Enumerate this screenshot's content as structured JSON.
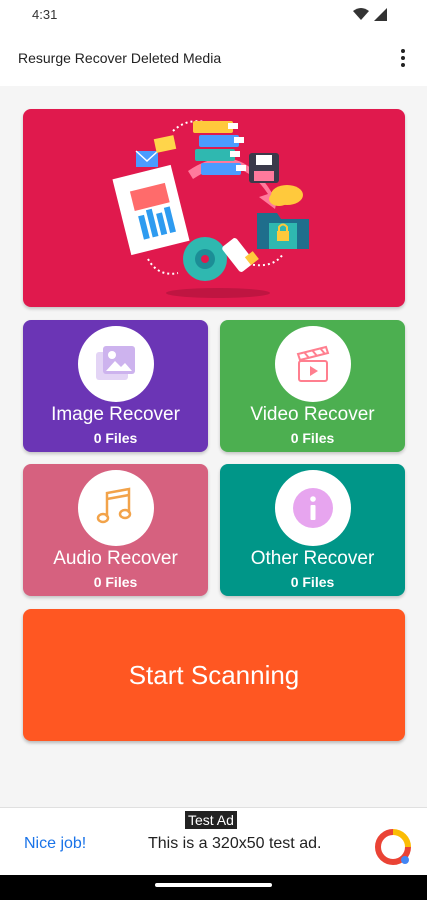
{
  "status_bar": {
    "time": "4:31"
  },
  "app_bar": {
    "title": "Resurge Recover Deleted Media"
  },
  "tiles": [
    {
      "title": "Image Recover",
      "count": "0 Files",
      "color": "#6b35b5",
      "icon": "image-icon"
    },
    {
      "title": "Video Recover",
      "count": "0 Files",
      "color": "#4caf50",
      "icon": "clapperboard-icon"
    },
    {
      "title": "Audio Recover",
      "count": "0 Files",
      "color": "#d6617f",
      "icon": "music-note-icon"
    },
    {
      "title": "Other Recover",
      "count": "0 Files",
      "color": "#009688",
      "icon": "info-icon"
    }
  ],
  "scan": {
    "label": "Start Scanning",
    "color": "#ff5722"
  },
  "ad": {
    "label": "Test Ad",
    "nice": "Nice job!",
    "text": "This is a 320x50 test ad."
  },
  "colors": {
    "hero": "#e0194d",
    "content_bg": "#f5f5f5"
  }
}
